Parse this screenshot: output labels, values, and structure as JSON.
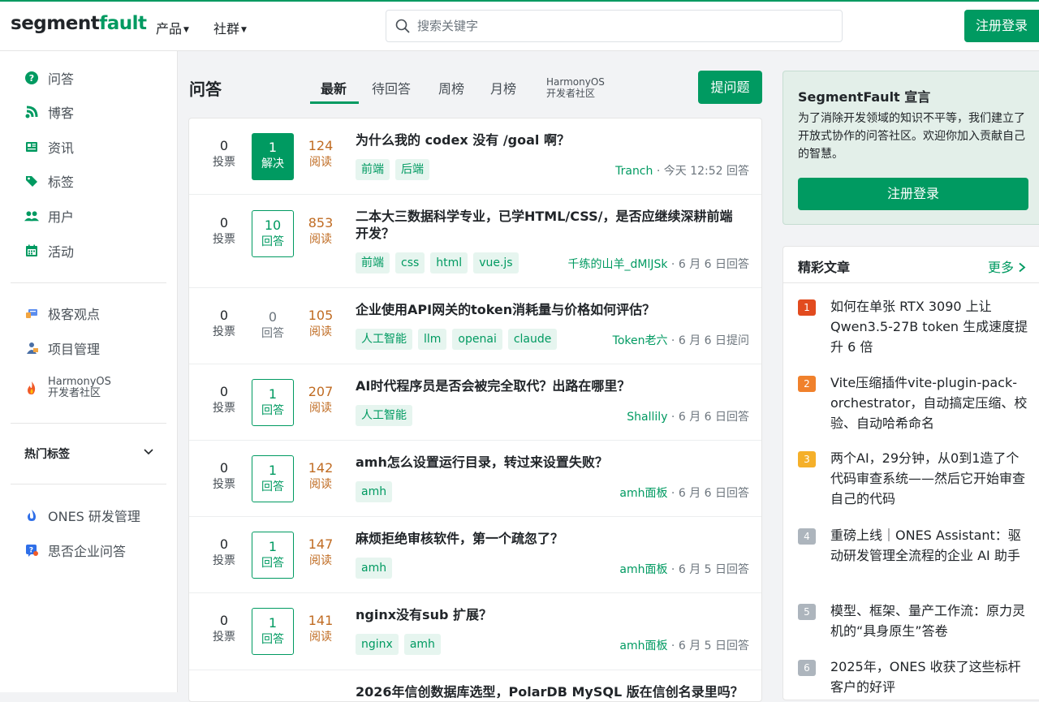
{
  "header": {
    "logo_a": "segment",
    "logo_b": "fault",
    "nav": [
      {
        "label": "产品"
      },
      {
        "label": "社群"
      }
    ],
    "search_placeholder": "搜索关键字",
    "login_label": "注册登录"
  },
  "sidebar": {
    "main": [
      {
        "label": "问答"
      },
      {
        "label": "博客"
      },
      {
        "label": "资讯"
      },
      {
        "label": "标签"
      },
      {
        "label": "用户"
      },
      {
        "label": "活动"
      }
    ],
    "special": [
      {
        "label": "极客观点"
      },
      {
        "label": "项目管理"
      },
      {
        "label_line1": "HarmonyOS",
        "label_line2": "开发者社区"
      }
    ],
    "hot_tags": "热门标签",
    "partners": [
      {
        "label": "ONES 研发管理"
      },
      {
        "label": "思否企业问答"
      }
    ]
  },
  "main": {
    "title": "问答",
    "tabs": [
      {
        "label": "最新"
      },
      {
        "label": "待回答"
      },
      {
        "label": "周榜"
      },
      {
        "label": "月榜"
      }
    ],
    "tab_harmony_line1": "HarmonyOS",
    "tab_harmony_line2": "开发者社区",
    "ask_label": "提问题",
    "questions": [
      {
        "votes": "0",
        "votes_label": "投票",
        "answers": "1",
        "answers_label": "解决",
        "views": "124",
        "views_label": "阅读",
        "title": "为什么我的 codex 没有 /goal 啊？",
        "tags": [
          "前端",
          "后端"
        ],
        "user": "Tranch",
        "time": " · 今天 12:52 回答"
      },
      {
        "votes": "0",
        "votes_label": "投票",
        "answers": "10",
        "answers_label": "回答",
        "views": "853",
        "views_label": "阅读",
        "title": "二本大三数据科学专业，已学HTML/CSS/，是否应继续深耕前端开发？",
        "tags": [
          "前端",
          "css",
          "html",
          "vue.js"
        ],
        "user": "千练的山羊_dMlJSk",
        "time": " · 6 月 6 日回答"
      },
      {
        "votes": "0",
        "votes_label": "投票",
        "answers": "0",
        "answers_label": "回答",
        "views": "105",
        "views_label": "阅读",
        "title": "企业使用API网关的token消耗量与价格如何评估？",
        "tags": [
          "人工智能",
          "llm",
          "openai",
          "claude"
        ],
        "user": "Token老六",
        "time": " · 6 月 6 日提问"
      },
      {
        "votes": "0",
        "votes_label": "投票",
        "answers": "1",
        "answers_label": "回答",
        "views": "207",
        "views_label": "阅读",
        "title": "AI时代程序员是否会被完全取代？出路在哪里？",
        "tags": [
          "人工智能"
        ],
        "user": "Shallily",
        "time": " · 6 月 6 日回答"
      },
      {
        "votes": "0",
        "votes_label": "投票",
        "answers": "1",
        "answers_label": "回答",
        "views": "142",
        "views_label": "阅读",
        "title": "amh怎么设置运行目录，转过来设置失败？",
        "tags": [
          "amh"
        ],
        "user": "amh面板",
        "time": " · 6 月 6 日回答"
      },
      {
        "votes": "0",
        "votes_label": "投票",
        "answers": "1",
        "answers_label": "回答",
        "views": "147",
        "views_label": "阅读",
        "title": "麻烦拒绝审核软件，第一个疏忽了？",
        "tags": [
          "amh"
        ],
        "user": "amh面板",
        "time": " · 6 月 5 日回答"
      },
      {
        "votes": "0",
        "votes_label": "投票",
        "answers": "1",
        "answers_label": "回答",
        "views": "141",
        "views_label": "阅读",
        "title": "nginx没有sub 扩展？",
        "tags": [
          "nginx",
          "amh"
        ],
        "user": "amh面板",
        "time": " · 6 月 5 日回答"
      },
      {
        "votes": "",
        "votes_label": "",
        "answers": "",
        "answers_label": "",
        "views": "",
        "views_label": "",
        "title": "2026年信创数据库选型，PolarDB MySQL 版在信创名录里吗？",
        "tags": [],
        "user": "",
        "time": ""
      }
    ]
  },
  "promo": {
    "title": "SegmentFault 宣言",
    "desc": "为了消除开发领域的知识不平等，我们建立了开放式协作的问答社区。欢迎你加入贡献自己的智慧。",
    "button": "注册登录"
  },
  "articles": {
    "title": "精彩文章",
    "more": "更多",
    "items": [
      {
        "num": "1",
        "color": "#e24b1f",
        "text": "如何在单张 RTX 3090 上让 Qwen3.5-27B token 生成速度提升 6 倍"
      },
      {
        "num": "2",
        "color": "#f0812c",
        "text": "Vite压缩插件vite-plugin-pack-orchestrator，自动搞定压缩、校验、自动哈希命名"
      },
      {
        "num": "3",
        "color": "#f5b02a",
        "text": "两个AI，29分钟，从0到1造了个代码审查系统——然后它开始审查自己的代码"
      },
      {
        "num": "4",
        "color": "#adb5bd",
        "text": "重磅上线｜ONES Assistant：驱动研发管理全流程的企业 AI 助手"
      },
      {
        "num": "5",
        "color": "#adb5bd",
        "text": "模型、框架、量产工作流：原力灵机的“具身原生”答卷"
      },
      {
        "num": "6",
        "color": "#adb5bd",
        "text": "2025年，ONES 收获了这些标杆客户的好评"
      }
    ]
  },
  "colors": {
    "brand": "#009a61",
    "views": "#c06c23"
  }
}
